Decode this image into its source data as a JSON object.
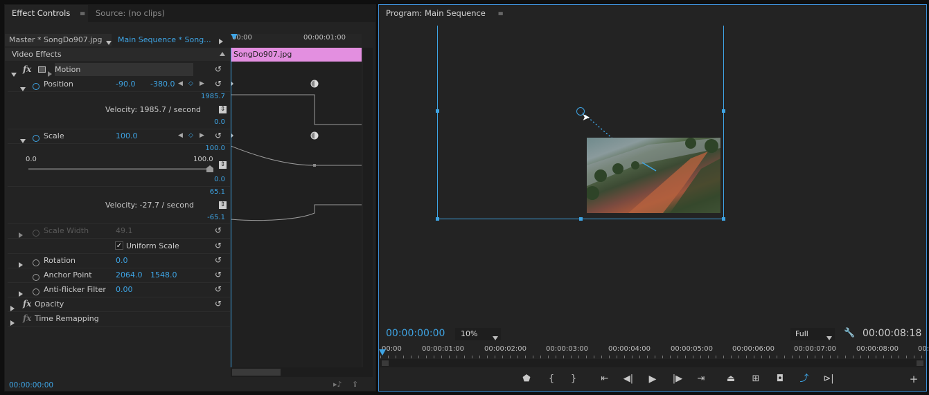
{
  "effect_controls": {
    "tab_label": "Effect Controls",
    "tab_menu": "≡",
    "source_tab_label": "Source: (no clips)",
    "master_clip": "Master * SongDo907.jpg",
    "sequence_clip": "Main Sequence * Song...",
    "ruler_start": "00:00",
    "ruler_mid": "00:00:01:00",
    "clip_bar_label": "SongDo907.jpg",
    "section_header": "Video Effects",
    "motion_label": "Motion",
    "position": {
      "label": "Position",
      "x": "-90.0",
      "y": "-380.0",
      "graph_max": "1985.7",
      "graph_min": "0.0",
      "velocity": "Velocity: 1985.7 / second"
    },
    "scale": {
      "label": "Scale",
      "value": "100.0",
      "graph_max": "100.0",
      "graph_min": "0.0",
      "slider_min": "0.0",
      "slider_max": "100.0",
      "vel_max": "65.1",
      "vel_min": "-65.1",
      "velocity": "Velocity: -27.7 / second"
    },
    "scale_width": {
      "label": "Scale Width",
      "value": "49.1"
    },
    "uniform_scale": {
      "label": "Uniform Scale",
      "checked": true
    },
    "rotation": {
      "label": "Rotation",
      "value": "0.0"
    },
    "anchor_point": {
      "label": "Anchor Point",
      "x": "2064.0",
      "y": "1548.0"
    },
    "anti_flicker": {
      "label": "Anti-flicker Filter",
      "value": "0.00"
    },
    "opacity_label": "Opacity",
    "time_remap_label": "Time Remapping",
    "timecode": "00:00:00:00"
  },
  "program_monitor": {
    "tab_label": "Program: Main Sequence",
    "tab_menu": "≡",
    "timecode_current": "00:00:00:00",
    "zoom": "10%",
    "quality": "Full",
    "duration": "00:00:08:18",
    "ruler_ticks": [
      "00:00",
      "00:00:01:00",
      "00:00:02:00",
      "00:00:03:00",
      "00:00:04:00",
      "00:00:05:00",
      "00:00:06:00",
      "00:00:07:00",
      "00:00:08:00",
      "00:00"
    ]
  },
  "colors": {
    "accent": "#3ea4e4",
    "clip_bar": "#e38fe0",
    "panel_bg": "#232323"
  },
  "icons": [
    "reset-icon",
    "stopwatch-icon",
    "keyframe-add-icon",
    "marker-icon",
    "mark-in-icon",
    "mark-out-icon",
    "go-to-in-icon",
    "step-back-icon",
    "play-icon",
    "step-forward-icon",
    "go-to-out-icon",
    "lift-icon",
    "extract-icon",
    "export-frame-icon",
    "comparison-view-icon",
    "trim-icon",
    "add-button-icon",
    "wrench-icon"
  ]
}
